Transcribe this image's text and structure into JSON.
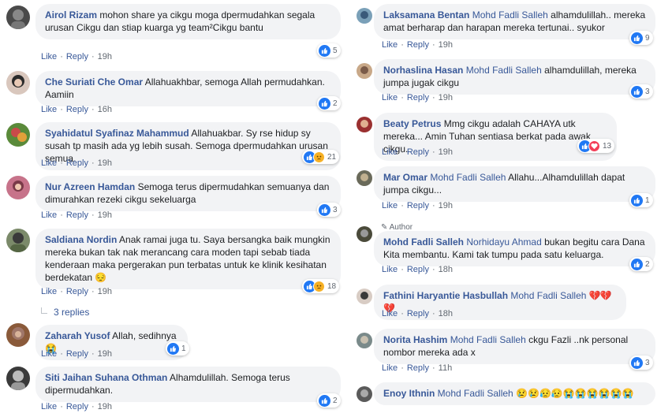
{
  "labels": {
    "like": "Like",
    "reply": "Reply",
    "author": "Author",
    "replies": "3 replies"
  },
  "colors": {
    "link": "#385898",
    "bubble": "#f2f3f5",
    "like": "#2078f4",
    "love": "#f33e58",
    "sad": "#f7b125"
  },
  "left": [
    {
      "name": "Airol Rizam",
      "text": "mohon share ya cikgu moga dpermudahkan segala urusan Cikgu dan stiap kuarga yg team²Cikgu bantu",
      "time": "19h",
      "reactions": [
        "like"
      ],
      "count": "5"
    },
    {
      "name": "Che Suriati Che Omar",
      "text": "Allahuakhbar, semoga Allah permudahkan. Aamiin",
      "time": "16h",
      "reactions": [
        "like"
      ],
      "count": "2"
    },
    {
      "name": "Syahidatul Syafinaz Mahammud",
      "text": "Allahuakbar. Sy rse hidup sy susah tp masih ada yg lebih susah. Semoga dpermudahkan urusan semua.",
      "time": "19h",
      "reactions": [
        "like",
        "sad"
      ],
      "count": "21"
    },
    {
      "name": "Nur Azreen Hamdan",
      "text": "Semoga terus dipermudahkan semuanya dan dimurahkan rezeki cikgu sekeluarga",
      "time": "19h",
      "reactions": [
        "like"
      ],
      "count": "3"
    },
    {
      "name": "Saldiana Nordin",
      "text": "Anak ramai juga tu. Saya bersangka baik mungkin mereka bukan tak nak merancang cara moden tapi sebab tiada kenderaan maka pergerakan pun terbatas untuk ke klinik kesihatan berdekatan 😔",
      "time": "19h",
      "reactions": [
        "like",
        "sad"
      ],
      "count": "18"
    },
    {
      "name": "Zaharah Yusof",
      "text": "Allah, sedihnya😭",
      "time": "19h",
      "reactions": [
        "like"
      ],
      "count": "1"
    },
    {
      "name": "Siti Jaihan Suhana Othman",
      "text": "Alhamdulillah. Semoga terus dipermudahkan.",
      "time": "19h",
      "reactions": [
        "like"
      ],
      "count": "2"
    }
  ],
  "right": [
    {
      "name": "Laksamana Bentan",
      "tag": "Mohd Fadli Salleh",
      "text": "alhamdulillah.. mereka amat berharap dan harapan mereka tertunai.. syukor",
      "time": "19h",
      "reactions": [
        "like"
      ],
      "count": "9"
    },
    {
      "name": "Norhaslina Hasan",
      "tag": "Mohd Fadli Salleh",
      "text": "alhamdulillah, mereka jumpa jugak cikgu",
      "time": "19h",
      "reactions": [
        "like"
      ],
      "count": "3"
    },
    {
      "name": "Beaty Petrus",
      "tag": "",
      "text": "Mmg cikgu adalah CAHAYA utk mereka... Amin Tuhan sentiasa berkat pada awak cikgu.",
      "time": "19h",
      "reactions": [
        "like",
        "love"
      ],
      "count": "13"
    },
    {
      "name": "Mar Omar",
      "tag": "Mohd Fadli Salleh",
      "text": "Allahu...Alhamdulillah dapat jumpa cikgu...",
      "time": "19h",
      "reactions": [
        "like"
      ],
      "count": "1"
    },
    {
      "name": "Mohd Fadli Salleh",
      "tag": "Norhidayu Ahmad",
      "text": "bukan begitu cara Dana Kita membantu. Kami tak tumpu pada satu keluarga.",
      "time": "18h",
      "reactions": [
        "like"
      ],
      "count": "2"
    },
    {
      "name": "Fathini Haryantie Hasbullah",
      "tag": "Mohd Fadli Salleh",
      "text": "💔💔💔",
      "time": "18h",
      "reactions": [],
      "count": ""
    },
    {
      "name": "Norita Hashim",
      "tag": "Mohd Fadli Salleh",
      "text": "ckgu Fazli ..nk personal nombor mereka ada x",
      "time": "11h",
      "reactions": [
        "like"
      ],
      "count": "3"
    },
    {
      "name": "Enoy Ithnin",
      "tag": "Mohd Fadli Salleh",
      "text": "😢😢😥😥😭😭😭😭😭😭",
      "time": "",
      "reactions": [],
      "count": ""
    }
  ]
}
